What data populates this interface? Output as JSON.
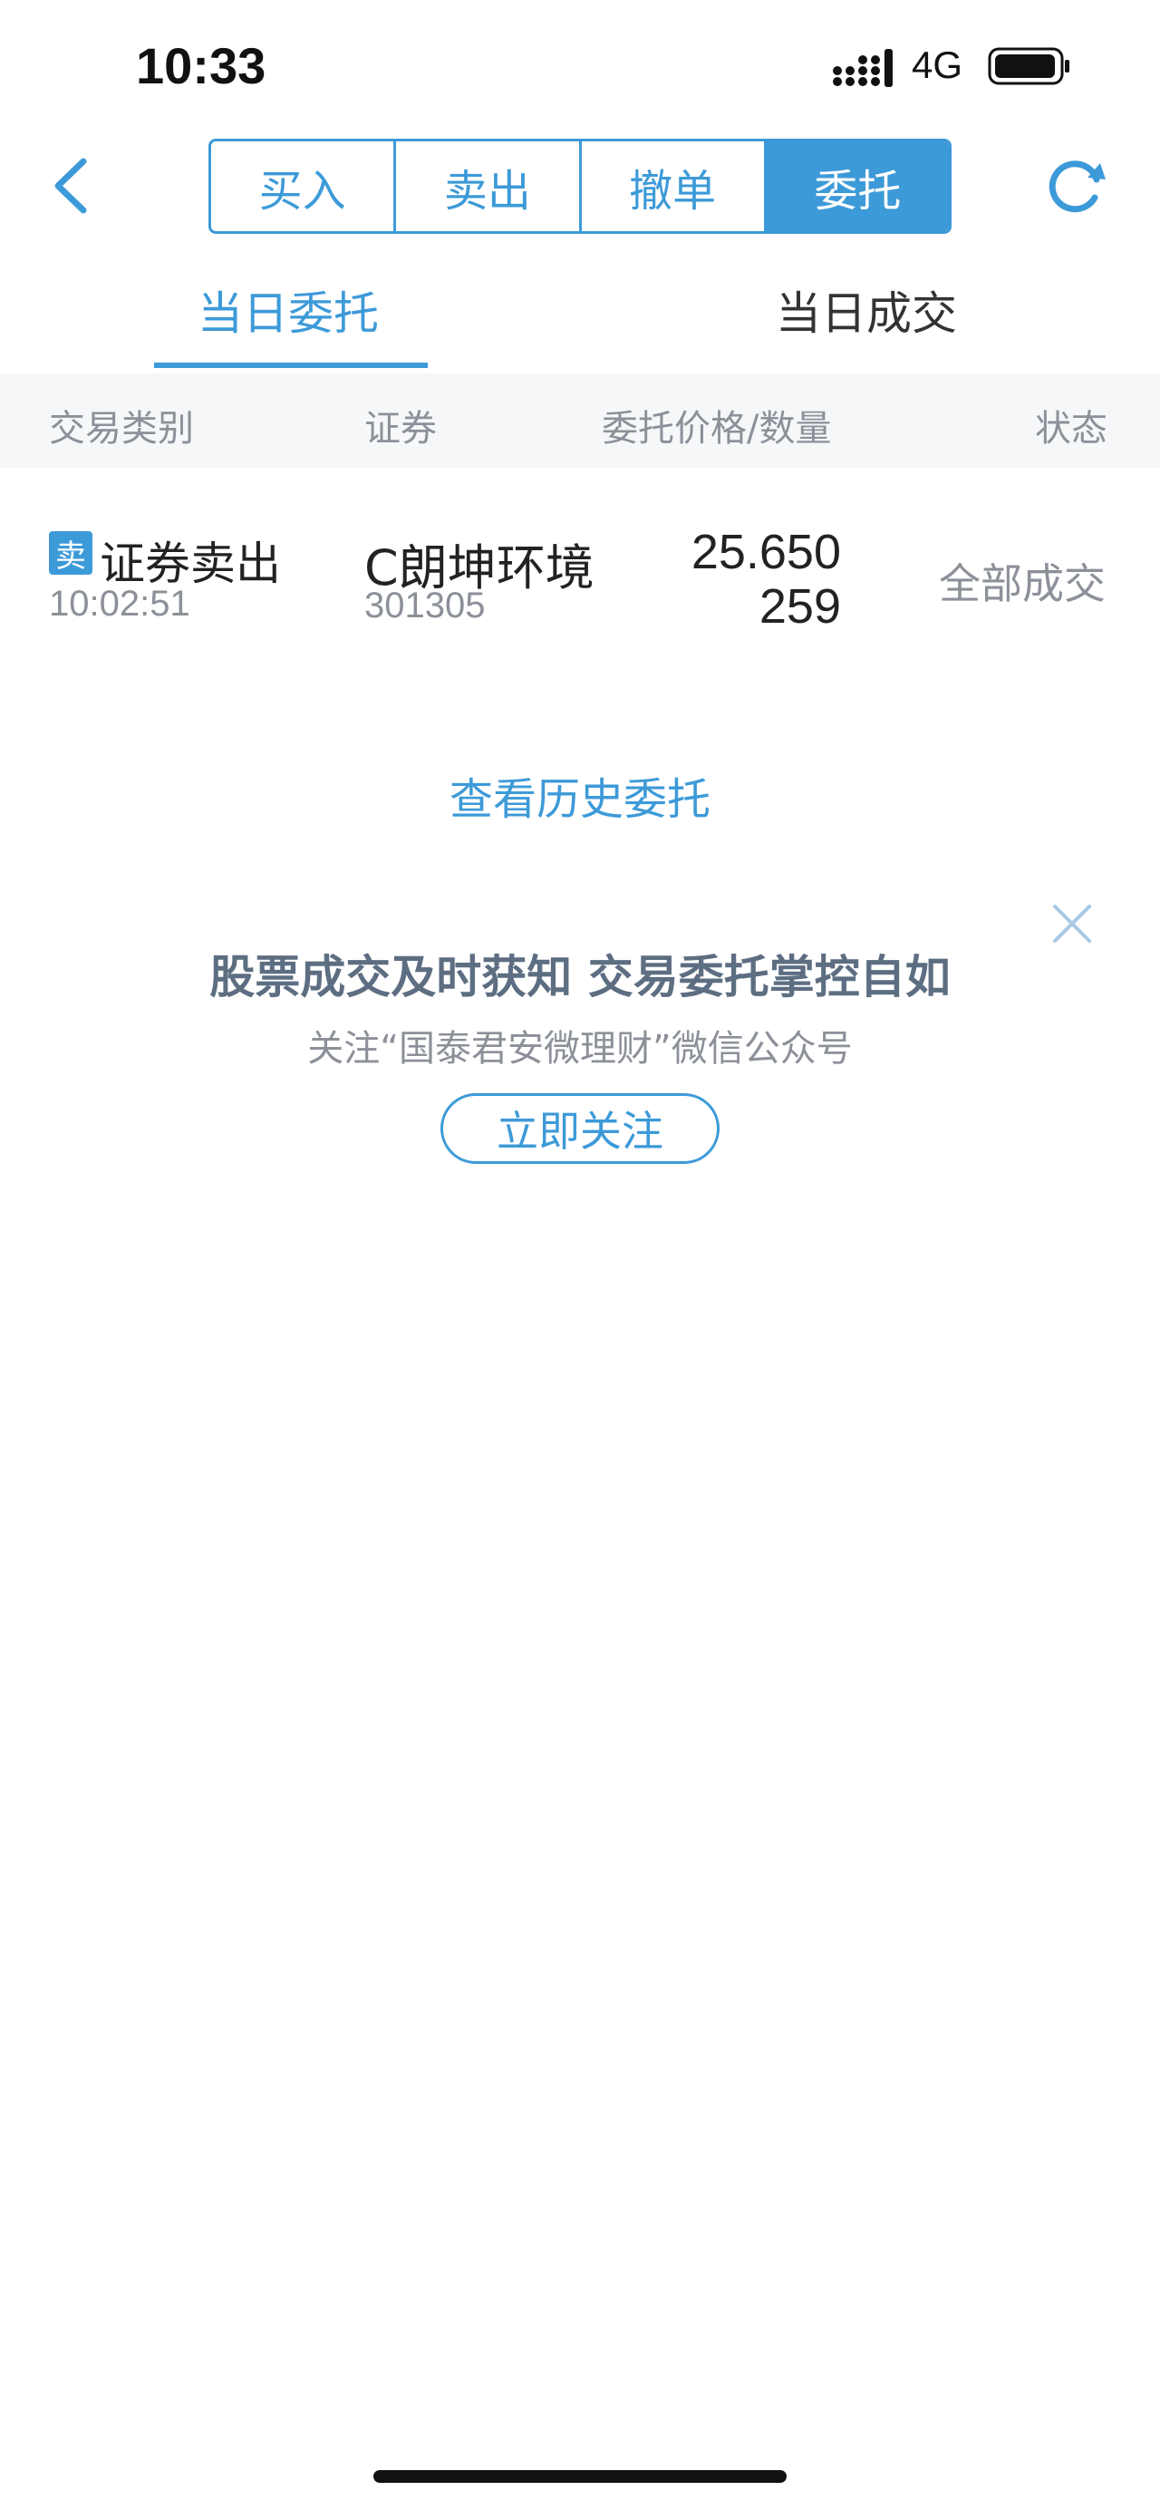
{
  "status_bar": {
    "time": "10:33",
    "network": "4G"
  },
  "nav": {
    "segments": [
      {
        "label": "买入"
      },
      {
        "label": "卖出"
      },
      {
        "label": "撤单"
      },
      {
        "label": "委托"
      }
    ],
    "active_segment": "委托"
  },
  "tabs": [
    {
      "label": "当日委托"
    },
    {
      "label": "当日成交"
    }
  ],
  "active_tab": "当日委托",
  "table": {
    "headers": [
      "交易类别",
      "证券",
      "委托价格/数量",
      "状态"
    ],
    "rows": [
      {
        "badge": "卖",
        "type": "证券卖出",
        "time": "10:02:51",
        "name": "C朗坤环境",
        "code": "301305",
        "price": "25.650",
        "quantity": "259",
        "status": "全部成交"
      }
    ]
  },
  "history_link": "查看历史委托",
  "promo": {
    "title": "股票成交及时获知 交易委托掌控自如",
    "subtitle": "关注“国泰君安微理财”微信公众号",
    "button": "立即关注"
  },
  "colors": {
    "accent": "#3d9ad8",
    "muted_text": "#8c9099",
    "header_bg": "#f6f7f9"
  }
}
